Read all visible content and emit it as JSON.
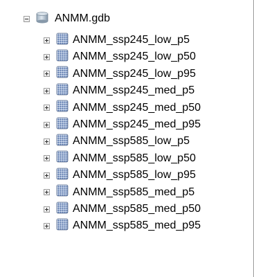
{
  "tree": {
    "root": {
      "label": "ANMM.gdb",
      "icon": "geodatabase-icon",
      "expanded": true
    },
    "children": [
      {
        "label": "ANMM_ssp245_low_p5",
        "icon": "raster-dataset-icon"
      },
      {
        "label": "ANMM_ssp245_low_p50",
        "icon": "raster-dataset-icon"
      },
      {
        "label": "ANMM_ssp245_low_p95",
        "icon": "raster-dataset-icon"
      },
      {
        "label": "ANMM_ssp245_med_p5",
        "icon": "raster-dataset-icon"
      },
      {
        "label": "ANMM_ssp245_med_p50",
        "icon": "raster-dataset-icon"
      },
      {
        "label": "ANMM_ssp245_med_p95",
        "icon": "raster-dataset-icon"
      },
      {
        "label": "ANMM_ssp585_low_p5",
        "icon": "raster-dataset-icon"
      },
      {
        "label": "ANMM_ssp585_low_p50",
        "icon": "raster-dataset-icon"
      },
      {
        "label": "ANMM_ssp585_low_p95",
        "icon": "raster-dataset-icon"
      },
      {
        "label": "ANMM_ssp585_med_p5",
        "icon": "raster-dataset-icon"
      },
      {
        "label": "ANMM_ssp585_med_p50",
        "icon": "raster-dataset-icon"
      },
      {
        "label": "ANMM_ssp585_med_p95",
        "icon": "raster-dataset-icon"
      }
    ]
  }
}
